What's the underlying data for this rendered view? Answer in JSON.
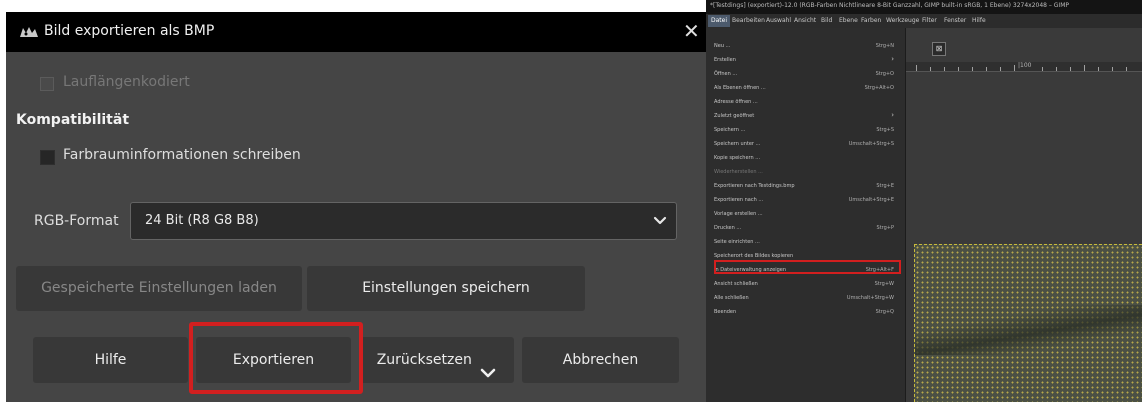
{
  "dialog": {
    "title": "Bild exportieren als BMP",
    "app_icon": "wilber-icon",
    "close_glyph": "✕",
    "rle_label": "Lauflängenkodiert",
    "compat_heading": "Kompatibilität",
    "color_space_label": "Farbrauminformationen schreiben",
    "rgb_label": "RGB-Format",
    "rgb_value": "24 Bit (R8 G8 B8)",
    "load_button": "Gespeicherte Einstellungen laden",
    "save_button": "Einstellungen speichern",
    "help_button": "Hilfe",
    "export_button": "Exportieren",
    "reset_button": "Zurücksetzen",
    "cancel_button": "Abbrechen",
    "highlight_color": "#d21f1f"
  },
  "gimp": {
    "title": "*[Testdings] (exportiert)-12.0 (RGB-Farben Nichtlineare 8-Bit Ganzzahl, GIMP built-in sRGB, 1 Ebene) 3274x2048 – GIMP",
    "menubar": [
      "Datei",
      "Bearbeiten",
      "Auswahl",
      "Ansicht",
      "Bild",
      "Ebene",
      "Farben",
      "Werkzeuge",
      "Filter",
      "Fenster",
      "Hilfe"
    ],
    "ruler_label": "|100",
    "tab_glyph": "⊠",
    "menu_items": [
      {
        "label": "Neu ...",
        "shortcut": "Strg+N"
      },
      {
        "label": "Erstellen",
        "shortcut": "›"
      },
      {
        "label": "Öffnen ...",
        "shortcut": "Strg+O"
      },
      {
        "label": "Als Ebenen öffnen ...",
        "shortcut": "Strg+Alt+O"
      },
      {
        "label": "Adresse öffnen ...",
        "shortcut": ""
      },
      {
        "label": "Zuletzt geöffnet",
        "shortcut": "›"
      },
      {
        "label": "Speichern ...",
        "shortcut": "Strg+S"
      },
      {
        "label": "Speichern unter ...",
        "shortcut": "Umschalt+Strg+S"
      },
      {
        "label": "Kopie speichern ...",
        "shortcut": ""
      },
      {
        "label": "Wiederherstellen ...",
        "shortcut": ""
      },
      {
        "label": "Exportieren nach Testdings.bmp",
        "shortcut": "Strg+E"
      },
      {
        "label": "Exportieren nach ...",
        "shortcut": "Umschalt+Strg+E"
      },
      {
        "label": "Vorlage erstellen ...",
        "shortcut": ""
      },
      {
        "label": "Drucken ...",
        "shortcut": "Strg+P"
      },
      {
        "label": "Seite einrichten ...",
        "shortcut": ""
      },
      {
        "label": "Speicherort des Bildes kopieren",
        "shortcut": ""
      },
      {
        "label": "In Dateiverwaltung anzeigen",
        "shortcut": "Strg+Alt+F"
      },
      {
        "label": "Ansicht schließen",
        "shortcut": "Strg+W"
      },
      {
        "label": "Alle schließen",
        "shortcut": "Umschalt+Strg+W"
      },
      {
        "label": "Beenden",
        "shortcut": "Strg+Q"
      }
    ]
  }
}
